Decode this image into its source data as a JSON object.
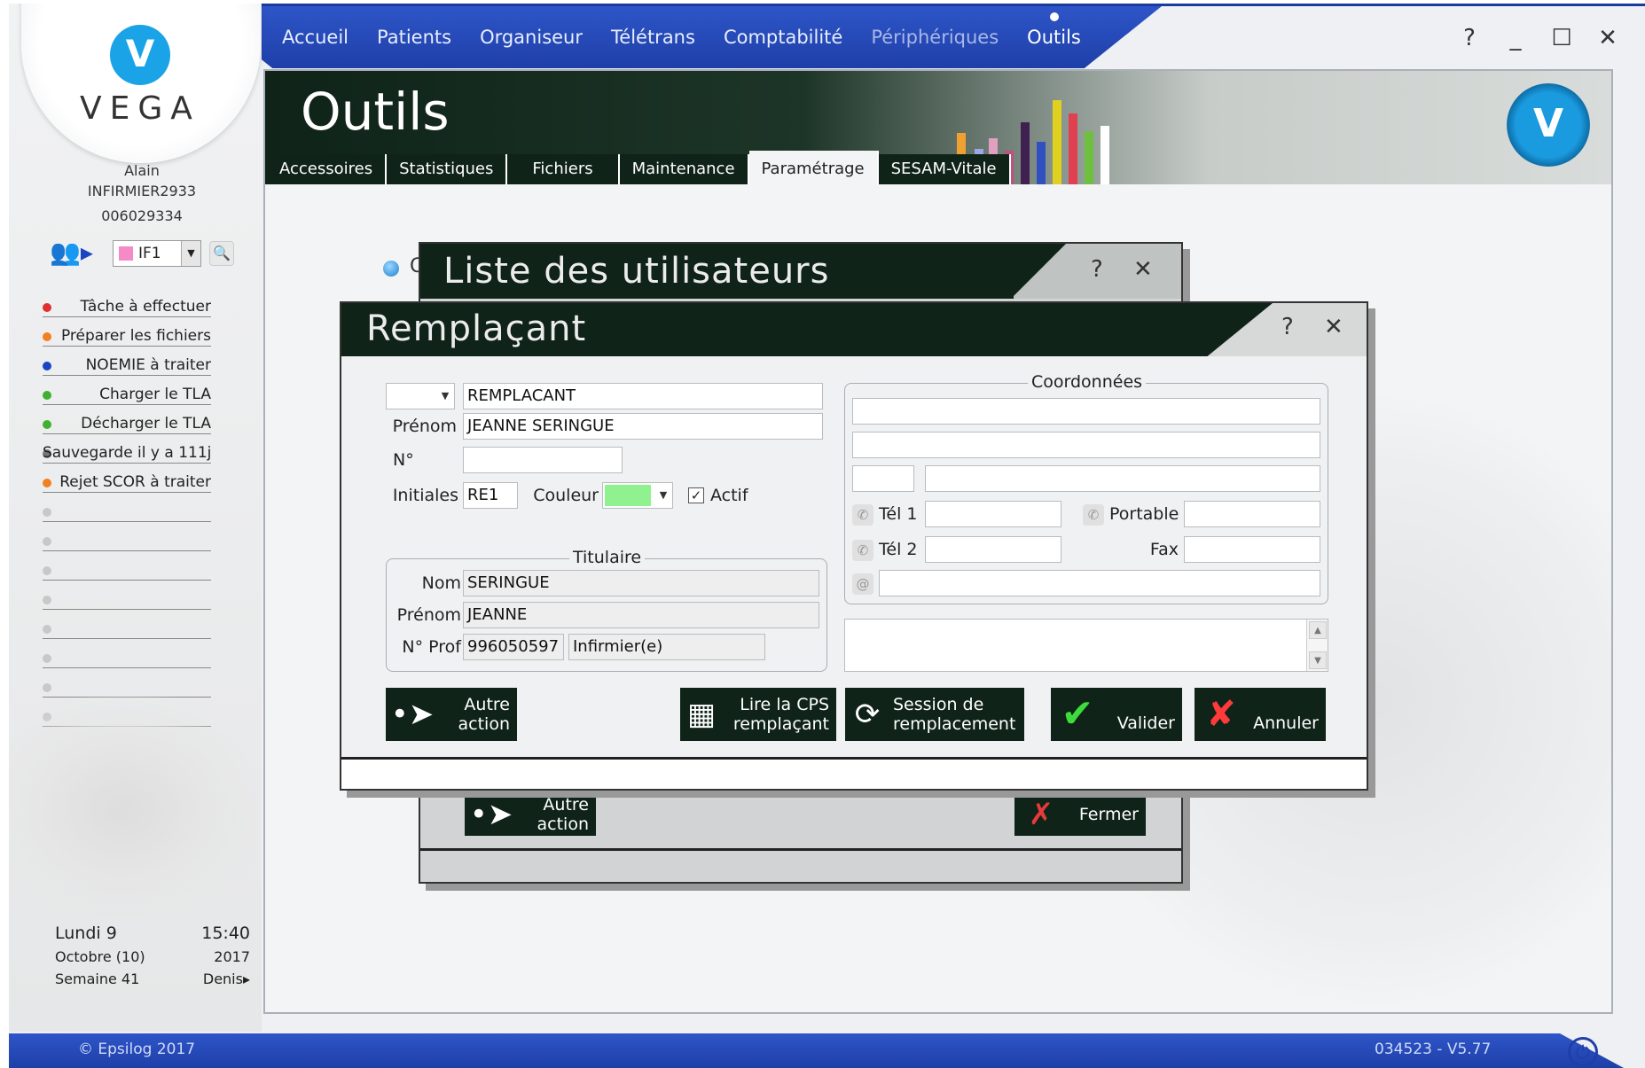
{
  "nav": {
    "items": [
      {
        "label": "Accueil"
      },
      {
        "label": "Patients"
      },
      {
        "label": "Organiseur"
      },
      {
        "label": "Télétrans"
      },
      {
        "label": "Comptabilité"
      },
      {
        "label": "Périphériques"
      },
      {
        "label": "Outils"
      }
    ],
    "active": "Outils"
  },
  "window_controls": {
    "help": "?",
    "minimize": "_",
    "maximize": "☐",
    "close": "✕"
  },
  "sidebar": {
    "logo": "VEGA",
    "user_name": "Alain",
    "user_id": "INFIRMIER2933",
    "user_number": "006029334",
    "profile_select": "IF1",
    "tasks": [
      {
        "label": "Tâche à effectuer",
        "color": "#e03030"
      },
      {
        "label": "Préparer les fichiers",
        "color": "#f08020"
      },
      {
        "label": "NOEMIE à traiter",
        "color": "#1a45c2"
      },
      {
        "label": "Charger le TLA",
        "color": "#40b030"
      },
      {
        "label": "Décharger le TLA",
        "color": "#40b030"
      },
      {
        "label": "Sauvegarde il y a 111j",
        "color": "#777777"
      },
      {
        "label": "Rejet SCOR à traiter",
        "color": "#f08020"
      },
      {
        "label": "",
        "color": "#c8c8c8"
      },
      {
        "label": "",
        "color": "#c8c8c8"
      },
      {
        "label": "",
        "color": "#c8c8c8"
      },
      {
        "label": "",
        "color": "#c8c8c8"
      },
      {
        "label": "",
        "color": "#c8c8c8"
      },
      {
        "label": "",
        "color": "#c8c8c8"
      },
      {
        "label": "",
        "color": "#c8c8c8"
      },
      {
        "label": "",
        "color": "#c8c8c8"
      }
    ],
    "date": {
      "day": "Lundi 9",
      "time": "15:40",
      "month": "Octobre (10)",
      "year": "2017",
      "week": "Semaine 41",
      "saint": "Denis"
    }
  },
  "panel": {
    "title": "Outils",
    "tabs": [
      "Accessoires",
      "Statistiques",
      "Fichiers",
      "Maintenance",
      "Paramétrage",
      "SESAM-Vitale"
    ],
    "active_tab": "Paramétrage",
    "bullet_letter": "C"
  },
  "dialog_back": {
    "title": "Liste des utilisateurs",
    "help": "?",
    "close": "✕",
    "autre_action": "Autre action",
    "fermer": "Fermer"
  },
  "dialog": {
    "title": "Remplaçant",
    "help": "?",
    "close": "✕",
    "civility": "",
    "nom": "REMPLACANT",
    "prenom_label": "Prénom",
    "prenom": "JEANNE SERINGUE",
    "numero_label": "N°",
    "numero": "",
    "initiales_label": "Initiales",
    "initiales": "RE1",
    "couleur_label": "Couleur",
    "couleur_value": "#8ff28f",
    "actif_label": "Actif",
    "actif_checked": true,
    "titulaire": {
      "title": "Titulaire",
      "nom_label": "Nom",
      "nom": "SERINGUE",
      "prenom_label": "Prénom",
      "prenom": "JEANNE",
      "nprof_label": "N° Prof",
      "nprof": "996050597",
      "profession": "Infirmier(e)"
    },
    "coordonnees": {
      "title": "Coordonnées",
      "address1": "",
      "address2": "",
      "cp": "",
      "ville": "",
      "tel1_label": "Tél 1",
      "tel1": "",
      "portable_label": "Portable",
      "portable": "",
      "tel2_label": "Tél 2",
      "tel2": "",
      "fax_label": "Fax",
      "fax": "",
      "email_icon": "@",
      "email": ""
    },
    "notes": "",
    "buttons": {
      "autre_action_1": "Autre",
      "autre_action_2": "action",
      "lire_cps_1": "Lire la CPS",
      "lire_cps_2": "remplaçant",
      "session_1": "Session de",
      "session_2": "remplacement",
      "valider": "Valider",
      "annuler": "Annuler"
    }
  },
  "status": {
    "copyright": "© Epsilog 2017",
    "version": "034523 - V5.77"
  }
}
